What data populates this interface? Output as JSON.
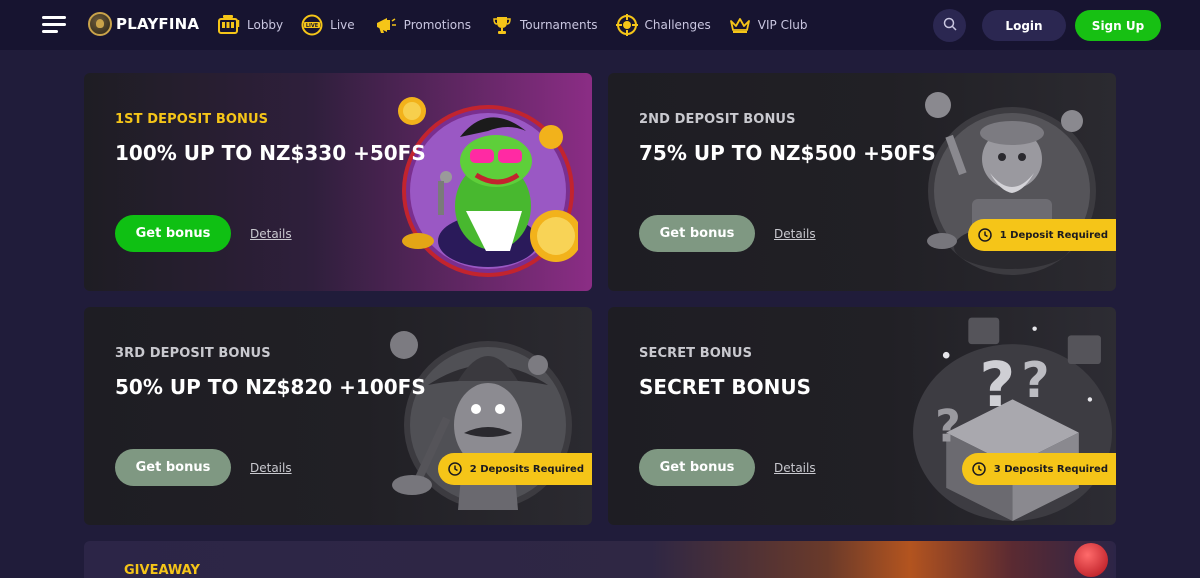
{
  "header": {
    "logo_text": "PLAYFINA",
    "nav": [
      {
        "label": "Lobby",
        "icon": "slot-machine-icon"
      },
      {
        "label": "Live",
        "icon": "live-icon"
      },
      {
        "label": "Promotions",
        "icon": "megaphone-icon"
      },
      {
        "label": "Tournaments",
        "icon": "trophy-icon"
      },
      {
        "label": "Challenges",
        "icon": "target-icon"
      },
      {
        "label": "VIP Club",
        "icon": "crown-icon"
      }
    ],
    "login_label": "Login",
    "signup_label": "Sign Up"
  },
  "cards": [
    {
      "label": "1ST DEPOSIT BONUS",
      "headline": "100% UP TO NZ$330 +50FS",
      "button": "Get bonus",
      "details": "Details",
      "requirement": ""
    },
    {
      "label": "2ND DEPOSIT BONUS",
      "headline": "75% UP TO NZ$500 +50FS",
      "button": "Get bonus",
      "details": "Details",
      "requirement": "1 Deposit Required"
    },
    {
      "label": "3RD DEPOSIT BONUS",
      "headline": "50% UP TO NZ$820 +100FS",
      "button": "Get bonus",
      "details": "Details",
      "requirement": "2 Deposits Required"
    },
    {
      "label": "SECRET BONUS",
      "headline": "SECRET BONUS",
      "button": "Get bonus",
      "details": "Details",
      "requirement": "3 Deposits Required"
    }
  ],
  "giveaway": {
    "label": "GIVEAWAY"
  },
  "colors": {
    "background": "#201c3a",
    "header": "#171430",
    "accent_green": "#17c013",
    "accent_yellow": "#f5c518",
    "muted_button": "#7f9882"
  }
}
